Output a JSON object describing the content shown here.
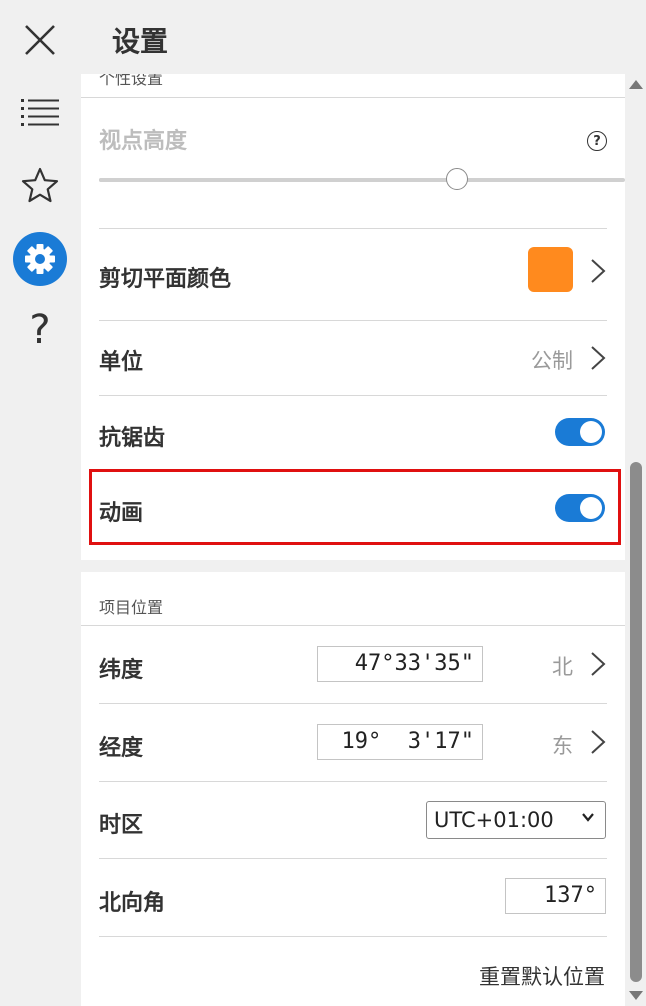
{
  "header": {
    "title": "设置"
  },
  "rail": {
    "close": "close-icon",
    "list": "list-icon",
    "favorites": "star-icon",
    "settings": "gear-icon",
    "help": "?"
  },
  "personal": {
    "section_title": "个性设置",
    "viewpoint_height": {
      "label": "视点高度",
      "slider_fraction": 0.68
    },
    "clip_color": {
      "label": "剪切平面颜色",
      "swatch": "#ff8a1e"
    },
    "units": {
      "label": "单位",
      "value": "公制"
    },
    "antialias": {
      "label": "抗锯齿",
      "on": true
    },
    "animation": {
      "label": "动画",
      "on": true
    }
  },
  "project_location": {
    "section_title": "项目位置",
    "latitude": {
      "label": "纬度",
      "value": "47°33'35\"",
      "hemisphere": "北"
    },
    "longitude": {
      "label": "经度",
      "value": "19°  3'17\"",
      "hemisphere": "东"
    },
    "timezone": {
      "label": "时区",
      "value": "UTC+01:00"
    },
    "north_angle": {
      "label": "北向角",
      "value": "137°"
    },
    "reset_label": "重置默认位置"
  },
  "colors": {
    "accent": "#1a7bd6",
    "highlight_border": "#e01010"
  }
}
